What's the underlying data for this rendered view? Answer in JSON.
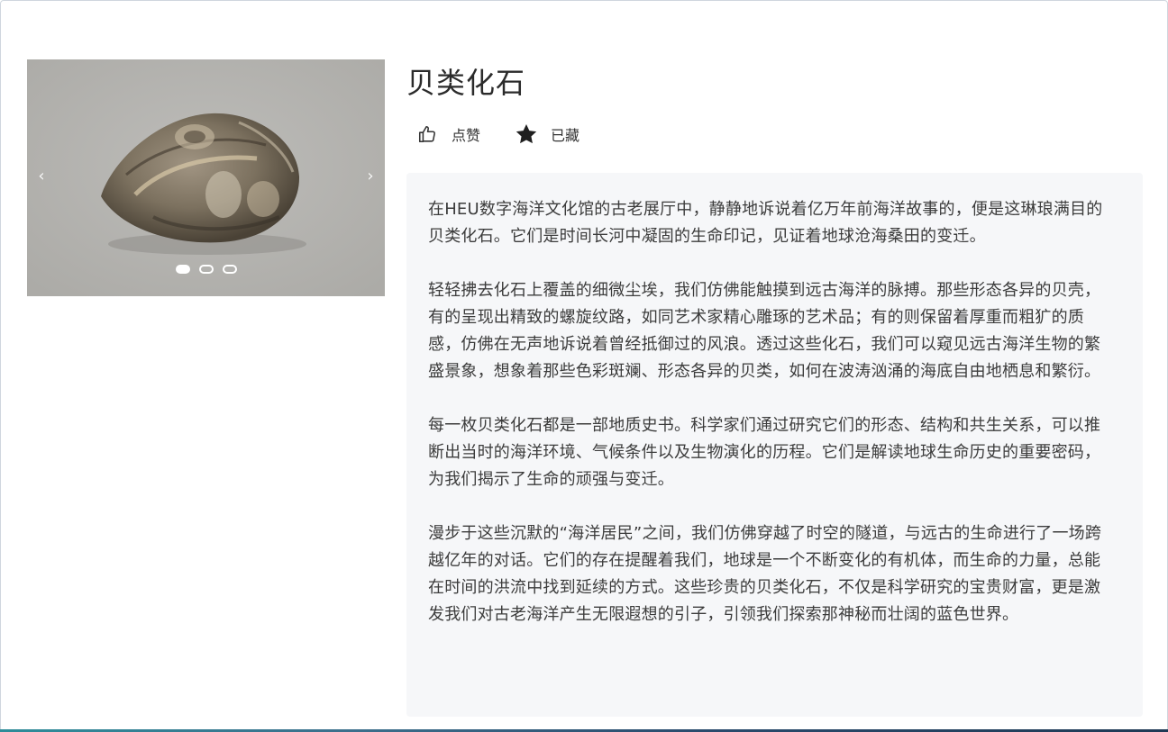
{
  "item": {
    "title": "贝类化石"
  },
  "carousel": {
    "prev_symbol": "‹",
    "next_symbol": "›",
    "slide_count": 3,
    "active_index": 0
  },
  "actions": {
    "like_label": "点赞",
    "favorite_label": "已藏",
    "like_icon": "thumbs-up-icon",
    "favorite_icon": "star-icon"
  },
  "description": {
    "paragraphs": [
      "在HEU数字海洋文化馆的古老展厅中，静静地诉说着亿万年前海洋故事的，便是这琳琅满目的贝类化石。它们是时间长河中凝固的生命印记，见证着地球沧海桑田的变迁。",
      "轻轻拂去化石上覆盖的细微尘埃，我们仿佛能触摸到远古海洋的脉搏。那些形态各异的贝壳，有的呈现出精致的螺旋纹路，如同艺术家精心雕琢的艺术品；有的则保留着厚重而粗犷的质感，仿佛在无声地诉说着曾经抵御过的风浪。透过这些化石，我们可以窥见远古海洋生物的繁盛景象，想象着那些色彩斑斓、形态各异的贝类，如何在波涛汹涌的海底自由地栖息和繁衍。",
      "每一枚贝类化石都是一部地质史书。科学家们通过研究它们的形态、结构和共生关系，可以推断出当时的海洋环境、气候条件以及生物演化的历程。它们是解读地球生命历史的重要密码，为我们揭示了生命的顽强与变迁。",
      "漫步于这些沉默的“海洋居民”之间，我们仿佛穿越了时空的隧道，与远古的生命进行了一场跨越亿年的对话。它们的存在提醒着我们，地球是一个不断变化的有机体，而生命的力量，总能在时间的洪流中找到延续的方式。这些珍贵的贝类化石，不仅是科学研究的宝贵财富，更是激发我们对古老海洋产生无限遐想的引子，引领我们探索那神秘而壮阔的蓝色世界。"
    ]
  }
}
